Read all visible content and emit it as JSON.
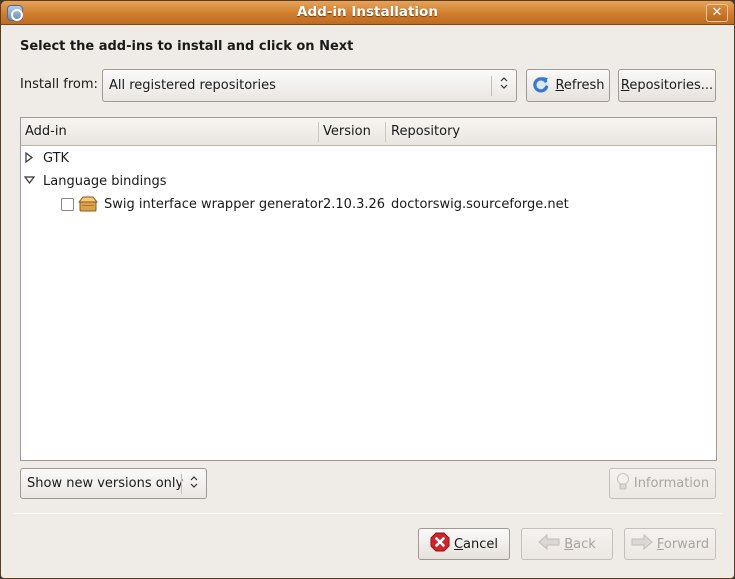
{
  "window": {
    "title": "Add-in Installation",
    "app_icon": "mono-addins-icon",
    "close_icon": "close-icon",
    "close_glyph": "✕"
  },
  "heading": "Select the add-ins to install and click on Next",
  "install_from": {
    "label": "Install from:",
    "selected": "All registered repositories",
    "arrow_glyph": "⬍"
  },
  "toolbar": {
    "refresh_label": "Refresh",
    "refresh_mnemonic": "R",
    "refresh_rest": "efresh",
    "repositories_mnemonic": "R",
    "repositories_rest": "epositories..."
  },
  "table": {
    "columns": [
      "Add-in",
      "Version",
      "Repository"
    ],
    "rows": [
      {
        "type": "category",
        "expanded": false,
        "label": "GTK",
        "expander_glyph": "▷"
      },
      {
        "type": "category",
        "expanded": true,
        "label": "Language bindings",
        "expander_glyph": "▽"
      },
      {
        "type": "addin",
        "checked": false,
        "name": "Swig interface wrapper generator",
        "version": "2.10.3.26",
        "repository": "doctorswig.sourceforge.net"
      }
    ]
  },
  "filter": {
    "selected": "Show new versions only",
    "arrow_glyph": "⬍"
  },
  "information_button": {
    "label": "Information",
    "enabled": false
  },
  "buttons": {
    "cancel_mnemonic": "C",
    "cancel_rest": "ancel",
    "back_mnemonic": "B",
    "back_rest": "ack",
    "back_enabled": false,
    "forward_mnemonic": "F",
    "forward_rest": "orward",
    "forward_enabled": false
  },
  "colors": {
    "titlebar": "#cf7d2c",
    "window_bg": "#efebe7",
    "cancel_icon": "#d2232a",
    "refresh_icon": "#3a78c8"
  }
}
